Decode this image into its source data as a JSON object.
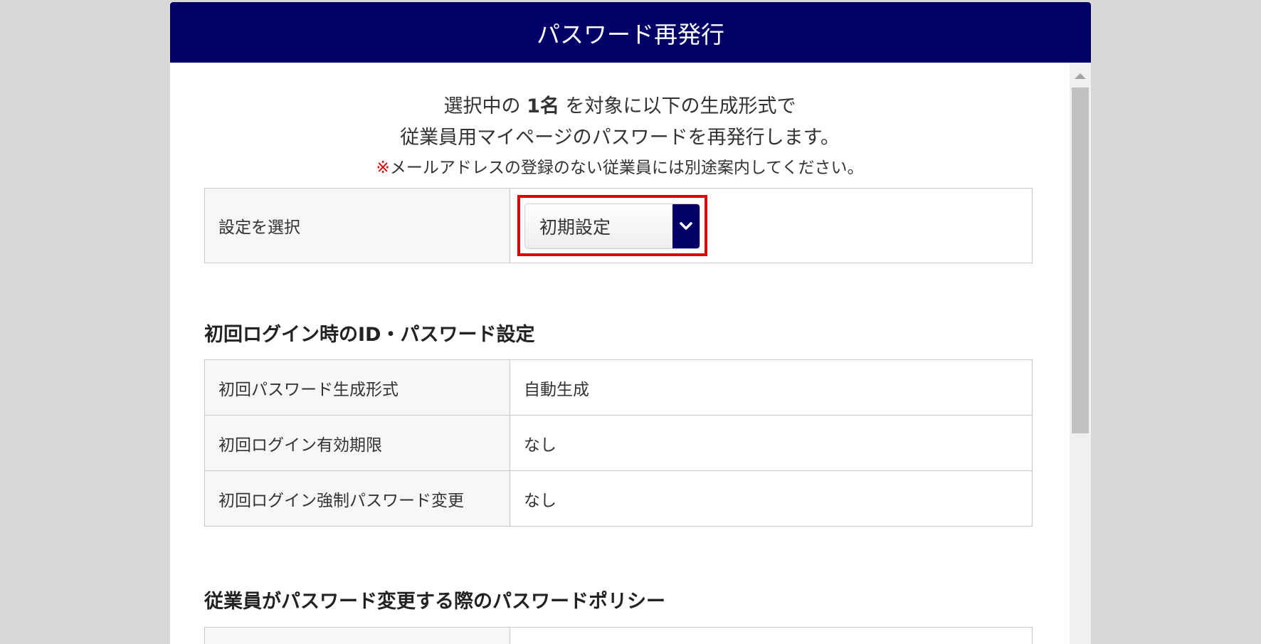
{
  "dialog": {
    "title": "パスワード再発行"
  },
  "intro": {
    "line1_pre": "選択中の",
    "line1_count": "1名",
    "line1_post": "を対象に以下の生成形式で",
    "line2": "従業員用マイページのパスワードを再発行します。",
    "note_mark": "※",
    "note": "メールアドレスの登録のない従業員には別途案内してください。"
  },
  "setting": {
    "label": "設定を選択",
    "selected": "初期設定"
  },
  "section1": {
    "title": "初回ログイン時のID・パスワード設定",
    "rows": [
      {
        "label": "初回パスワード生成形式",
        "value": "自動生成"
      },
      {
        "label": "初回ログイン有効期限",
        "value": "なし"
      },
      {
        "label": "初回ログイン強制パスワード変更",
        "value": "なし"
      }
    ]
  },
  "section2": {
    "title": "従業員がパスワード変更する際のパスワードポリシー"
  },
  "colors": {
    "header_bg": "#020066",
    "highlight": "#e00000",
    "note_mark": "#e00000"
  }
}
